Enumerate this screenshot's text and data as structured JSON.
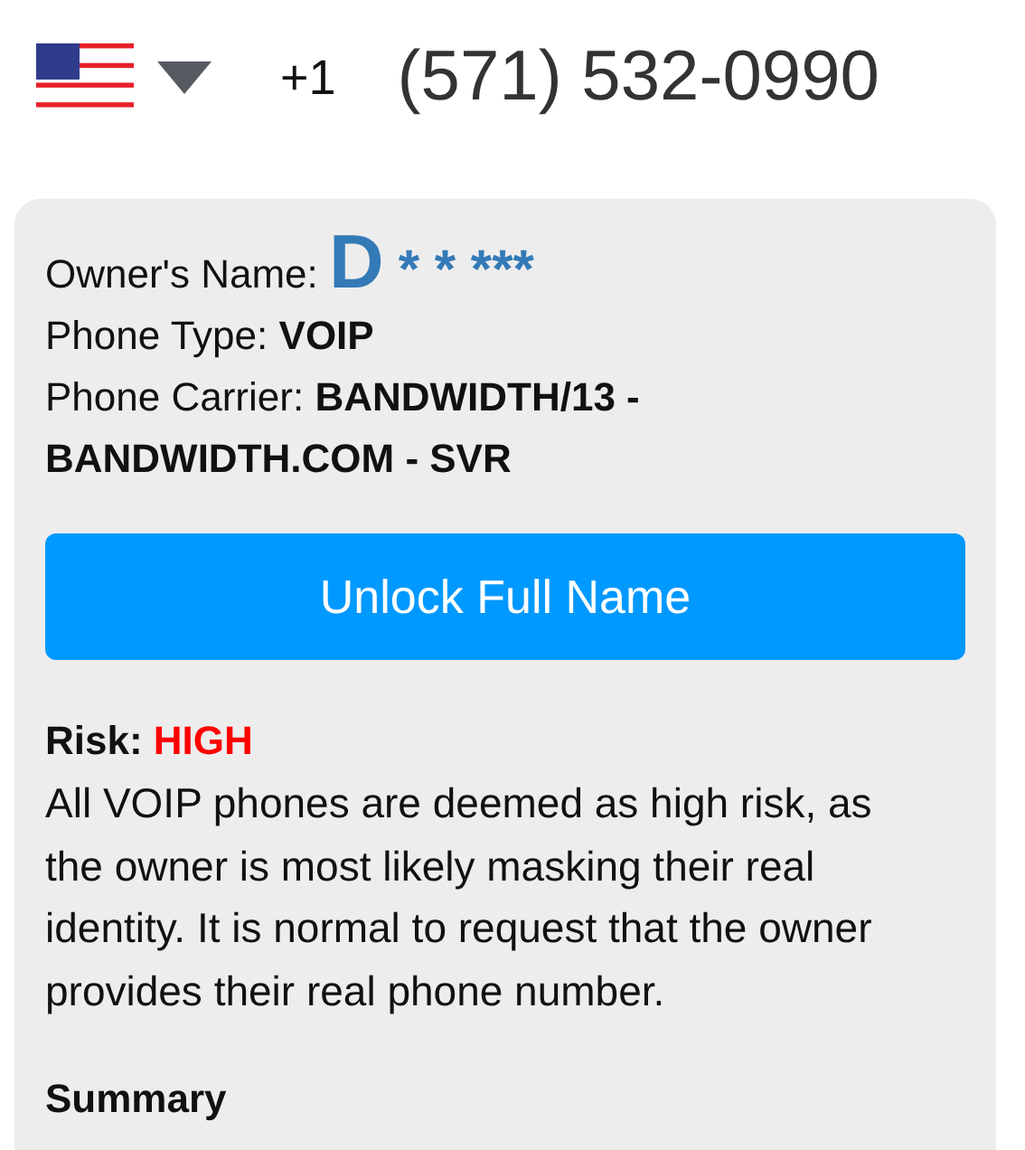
{
  "phone": {
    "country_code": "+1",
    "number": "(571) 532-0990"
  },
  "details": [
    {
      "label": "Owner's Name:",
      "initial": "D",
      "mask": "* * ***",
      "kind": "masked"
    },
    {
      "label": "Phone Type:",
      "value": "VOIP",
      "kind": "bold"
    },
    {
      "label": "Phone Carrier:",
      "value": "BANDWIDTH/13 - BANDWIDTH.COM - SVR",
      "kind": "bold"
    }
  ],
  "unlock_button": "Unlock Full Name",
  "risk": {
    "label": "Risk:",
    "value": "HIGH",
    "description": "All VOIP phones are deemed as high risk, as the owner is most likely masking their real identity. It is normal to request that the owner provides their real phone number."
  },
  "summary_heading": "Summary"
}
